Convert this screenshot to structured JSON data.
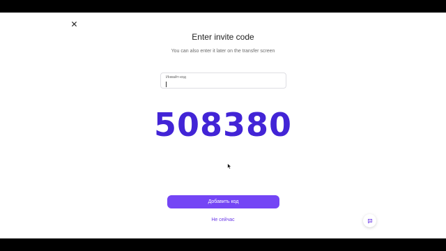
{
  "dialog": {
    "title": "Enter invite code",
    "subtitle": "You can also enter it later on the transfer screen",
    "input": {
      "label": "Инвайт-код",
      "value": "",
      "placeholder": ""
    },
    "code": "508380",
    "primary_button": "Добавить код",
    "secondary_link": "Не сейчас"
  },
  "icons": {
    "close": "close-icon",
    "chat": "chat-icon",
    "cursor": "mouse-pointer-icon"
  },
  "colors": {
    "accent": "#7445f5",
    "code_text": "#4224d6",
    "link": "#6a38e6",
    "letterbox": "#000000"
  }
}
